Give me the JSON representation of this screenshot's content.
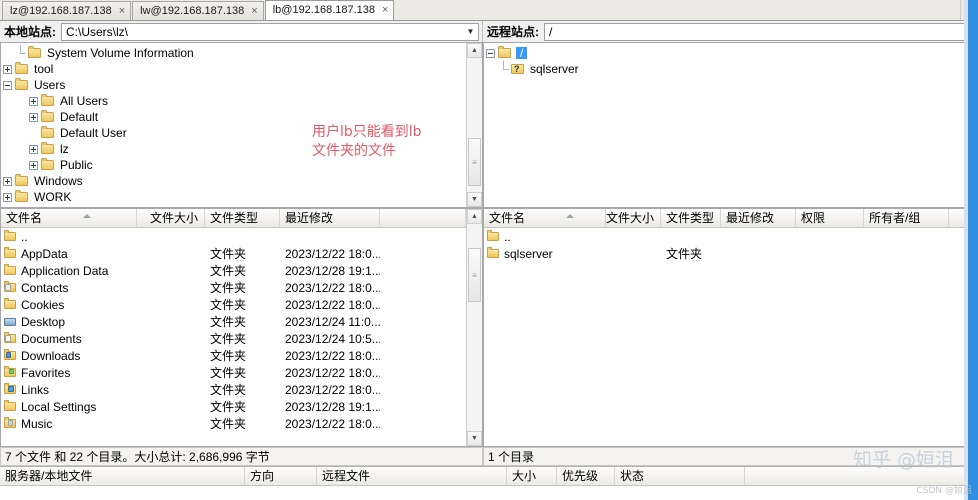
{
  "tabs": [
    {
      "label": "lz@192.168.187.138",
      "close": "×",
      "active": false
    },
    {
      "label": "lw@192.168.187.138",
      "close": "×",
      "active": false
    },
    {
      "label": "lb@192.168.187.138",
      "close": "×",
      "active": true
    }
  ],
  "tab_overflow_icon": "▼",
  "local": {
    "site_label": "本地站点:",
    "site_value": "C:\\Users\\lz\\",
    "combo_arrow": "▼",
    "tree": [
      {
        "label": "System Volume Information",
        "indent": 2,
        "twist": "none",
        "icon": "folder-icon"
      },
      {
        "label": "tool",
        "indent": 1,
        "twist": "plus",
        "icon": "folder-icon"
      },
      {
        "label": "Users",
        "indent": 1,
        "twist": "minus",
        "icon": "folder-icon"
      },
      {
        "label": "All Users",
        "indent": 2,
        "twist": "plus",
        "icon": "folder-icon"
      },
      {
        "label": "Default",
        "indent": 2,
        "twist": "plus",
        "icon": "folder-icon"
      },
      {
        "label": "Default User",
        "indent": 2,
        "twist": "none",
        "icon": "folder-icon"
      },
      {
        "label": "lz",
        "indent": 2,
        "twist": "plus",
        "icon": "folder-user-icon"
      },
      {
        "label": "Public",
        "indent": 2,
        "twist": "plus",
        "icon": "folder-icon"
      },
      {
        "label": "Windows",
        "indent": 1,
        "twist": "plus",
        "icon": "folder-icon"
      },
      {
        "label": "WORK",
        "indent": 1,
        "twist": "plus",
        "icon": "folder-icon"
      }
    ],
    "annotation": "用户lb只能看到lb\n文件夹的文件",
    "annotation_color": "#e05a66",
    "columns": [
      "文件名",
      "文件大小",
      "文件类型",
      "最近修改"
    ],
    "rows": [
      {
        "name": "..",
        "size": "",
        "type": "",
        "modified": "",
        "icon": "folder-icon"
      },
      {
        "name": "AppData",
        "size": "",
        "type": "文件夹",
        "modified": "2023/12/22 18:0...",
        "icon": "folder-icon"
      },
      {
        "name": "Application Data",
        "size": "",
        "type": "文件夹",
        "modified": "2023/12/28 19:1...",
        "icon": "folder-icon"
      },
      {
        "name": "Contacts",
        "size": "",
        "type": "文件夹",
        "modified": "2023/12/22 18:0...",
        "icon": "folder-contacts-icon"
      },
      {
        "name": "Cookies",
        "size": "",
        "type": "文件夹",
        "modified": "2023/12/22 18:0...",
        "icon": "folder-icon"
      },
      {
        "name": "Desktop",
        "size": "",
        "type": "文件夹",
        "modified": "2023/12/24 11:0...",
        "icon": "folder-desktop-icon"
      },
      {
        "name": "Documents",
        "size": "",
        "type": "文件夹",
        "modified": "2023/12/24 10:5...",
        "icon": "folder-documents-icon"
      },
      {
        "name": "Downloads",
        "size": "",
        "type": "文件夹",
        "modified": "2023/12/22 18:0...",
        "icon": "folder-downloads-icon"
      },
      {
        "name": "Favorites",
        "size": "",
        "type": "文件夹",
        "modified": "2023/12/22 18:0...",
        "icon": "folder-favorites-icon"
      },
      {
        "name": "Links",
        "size": "",
        "type": "文件夹",
        "modified": "2023/12/22 18:0...",
        "icon": "folder-links-icon"
      },
      {
        "name": "Local Settings",
        "size": "",
        "type": "文件夹",
        "modified": "2023/12/28 19:1...",
        "icon": "folder-icon"
      },
      {
        "name": "Music",
        "size": "",
        "type": "文件夹",
        "modified": "2023/12/22 18:0...",
        "icon": "folder-music-icon"
      }
    ],
    "status": "7 个文件 和 22 个目录。大小总计: 2,686,996 字节"
  },
  "remote": {
    "site_label": "远程站点:",
    "site_value": "/",
    "combo_arrow": "▼",
    "tree": [
      {
        "label": "/",
        "indent": 0,
        "twist": "minus",
        "icon": "folder-icon",
        "selected": true
      },
      {
        "label": "sqlserver",
        "indent": 1,
        "twist": "none",
        "icon": "folder-unknown-icon",
        "selected": false
      }
    ],
    "columns": [
      "文件名",
      "文件大小",
      "文件类型",
      "最近修改",
      "权限",
      "所有者/组"
    ],
    "rows": [
      {
        "name": "..",
        "size": "",
        "type": "",
        "modified": "",
        "perms": "",
        "owner": "",
        "icon": "folder-icon"
      },
      {
        "name": "sqlserver",
        "size": "",
        "type": "文件夹",
        "modified": "",
        "perms": "",
        "owner": "",
        "icon": "folder-icon"
      }
    ],
    "status": "1 个目录"
  },
  "queue": {
    "columns": [
      "服务器/本地文件",
      "方向",
      "远程文件",
      "大小",
      "优先级",
      "状态"
    ]
  },
  "scrollbar": {
    "up_arrow": "▲",
    "down_arrow": "▼",
    "grip": "≡"
  },
  "watermarks": {
    "zhihu": "知乎 @姮沮",
    "csdn": "CSDN @姮沮"
  }
}
